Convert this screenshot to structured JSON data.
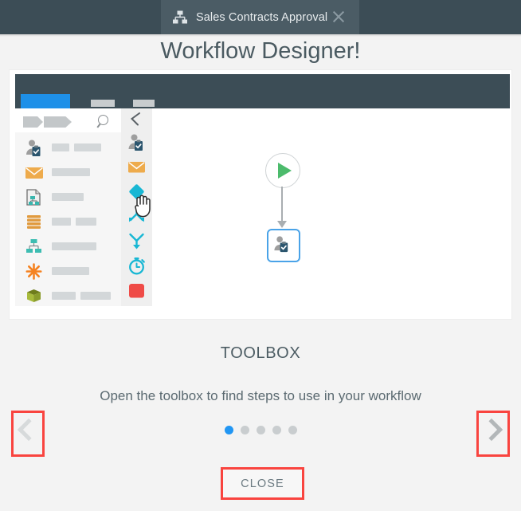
{
  "window": {
    "tab": {
      "title": "Sales Contracts Approval",
      "icon": "hierarchy-icon",
      "close_icon": "close-icon"
    },
    "bar_color": "#3c4d56",
    "tab_color": "#4b5c65"
  },
  "heading": "Workflow Designer!",
  "illustration": {
    "app_header_color": "#3c4d56",
    "active_tab_color": "#1e90e8",
    "toolbox": {
      "search_icon": "search-icon",
      "collapse_icon": "collapse-arrow-icon",
      "cursor_icon": "hand-cursor-icon",
      "items": [
        {
          "icon": "user-task-icon",
          "color": "#2b556e"
        },
        {
          "icon": "envelope-icon",
          "color": "#eeab4c"
        },
        {
          "icon": "document-flow-icon",
          "color": "#39b5ad"
        },
        {
          "icon": "database-icon",
          "color": "#e09a3e"
        },
        {
          "icon": "org-chart-icon",
          "color": "#3dbdb2"
        },
        {
          "icon": "asterisk-icon",
          "color": "#f58220"
        },
        {
          "icon": "package-icon",
          "color": "#97ab2f"
        }
      ],
      "strip_icons": [
        {
          "icon": "user-task-icon",
          "color": "#2b556e"
        },
        {
          "icon": "envelope-icon",
          "color": "#eeab4c"
        },
        {
          "icon": "diamond-icon",
          "color": "#18b7d4"
        },
        {
          "icon": "branch-icon",
          "color": "#18b7d4"
        },
        {
          "icon": "merge-icon",
          "color": "#18b7d4"
        },
        {
          "icon": "timer-icon",
          "color": "#18b7d4"
        },
        {
          "icon": "stop-icon",
          "color": "#ef4b47"
        }
      ]
    },
    "canvas": {
      "start_node_icon": "play-icon",
      "start_node_color": "#4cbb6c",
      "task_node_icon": "user-task-icon",
      "task_node_border": "#4aa3e8",
      "connector_color": "#a9aeb1"
    }
  },
  "caption": {
    "title": "TOOLBOX",
    "subtitle": "Open the toolbox to find steps to use in your workflow"
  },
  "pagination": {
    "total": 5,
    "active_index": 0,
    "active_color": "#2196f3",
    "inactive_color": "#c9cdcf"
  },
  "nav": {
    "prev_icon": "chevron-left-icon",
    "next_icon": "chevron-right-icon",
    "highlight_color": "#f9443f"
  },
  "footer": {
    "close_label": "CLOSE"
  }
}
